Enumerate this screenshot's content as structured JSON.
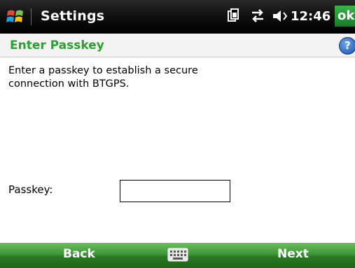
{
  "titlebar": {
    "title": "Settings",
    "clock": "12:46",
    "ok_label": "ok",
    "icons": [
      "windows-start-icon",
      "battery-icon",
      "connectivity-icon",
      "volume-icon"
    ]
  },
  "header": {
    "title": "Enter Passkey",
    "help_label": "?"
  },
  "main": {
    "instruction": "Enter a passkey to establish a secure connection with BTGPS.",
    "passkey_label": "Passkey:",
    "passkey_value": ""
  },
  "softkeys": {
    "left": "Back",
    "right": "Next"
  },
  "colors": {
    "accent_green": "#29a22f",
    "softkey_bar": "#3f9638",
    "titlebar": "#000000",
    "help_blue": "#1b4fa8"
  }
}
